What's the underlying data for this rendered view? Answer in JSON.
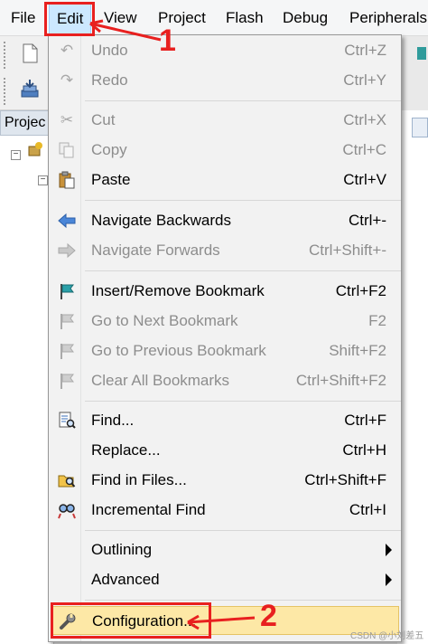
{
  "menubar": {
    "items": [
      "File",
      "Edit",
      "View",
      "Project",
      "Flash",
      "Debug",
      "Peripherals"
    ]
  },
  "project_panel": {
    "title": "Projec"
  },
  "menu": {
    "items": [
      {
        "label": "Undo",
        "shortcut": "Ctrl+Z",
        "icon": "undo-icon",
        "enabled": false
      },
      {
        "label": "Redo",
        "shortcut": "Ctrl+Y",
        "icon": "redo-icon",
        "enabled": false
      },
      {
        "label": "Cut",
        "shortcut": "Ctrl+X",
        "icon": "scissors-icon",
        "enabled": false
      },
      {
        "label": "Copy",
        "shortcut": "Ctrl+C",
        "icon": "copy-icon",
        "enabled": false
      },
      {
        "label": "Paste",
        "shortcut": "Ctrl+V",
        "icon": "paste-icon",
        "enabled": true
      },
      {
        "label": "Navigate Backwards",
        "shortcut": "Ctrl+-",
        "icon": "arrow-left-icon",
        "enabled": true
      },
      {
        "label": "Navigate Forwards",
        "shortcut": "Ctrl+Shift+-",
        "icon": "arrow-right-icon",
        "enabled": false
      },
      {
        "label": "Insert/Remove Bookmark",
        "shortcut": "Ctrl+F2",
        "icon": "bookmark-flag-icon",
        "enabled": true
      },
      {
        "label": "Go to Next Bookmark",
        "shortcut": "F2",
        "icon": "next-bookmark-icon",
        "enabled": false
      },
      {
        "label": "Go to Previous Bookmark",
        "shortcut": "Shift+F2",
        "icon": "previous-bookmark-icon",
        "enabled": false
      },
      {
        "label": "Clear All Bookmarks",
        "shortcut": "Ctrl+Shift+F2",
        "icon": "clear-bookmarks-icon",
        "enabled": false
      },
      {
        "label": "Find...",
        "shortcut": "Ctrl+F",
        "icon": "find-icon",
        "enabled": true
      },
      {
        "label": "Replace...",
        "shortcut": "Ctrl+H",
        "icon": "",
        "enabled": true
      },
      {
        "label": "Find in Files...",
        "shortcut": "Ctrl+Shift+F",
        "icon": "find-in-files-icon",
        "enabled": true
      },
      {
        "label": "Incremental Find",
        "shortcut": "Ctrl+I",
        "icon": "incremental-find-icon",
        "enabled": true
      },
      {
        "label": "Outlining",
        "shortcut": "",
        "icon": "",
        "enabled": true,
        "submenu": true
      },
      {
        "label": "Advanced",
        "shortcut": "",
        "icon": "",
        "enabled": true,
        "submenu": true
      },
      {
        "label": "Configuration...",
        "shortcut": "",
        "icon": "wrench-icon",
        "enabled": true,
        "highlighted": true
      }
    ]
  },
  "annotations": {
    "step1": "1",
    "step2": "2",
    "color": "#e8201f"
  },
  "watermark": "CSDN @小刘差五",
  "colors": {
    "highlight": "#fde8a6",
    "menubar_active": "#cce8ff",
    "disabled_text": "#8d8d8d"
  }
}
